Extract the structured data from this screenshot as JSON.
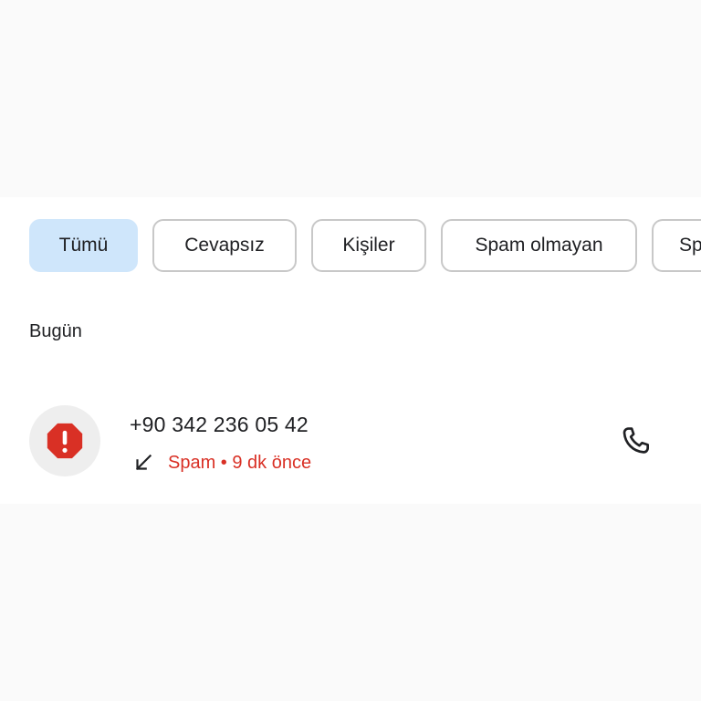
{
  "filters": {
    "chips": [
      {
        "label": "Tümü",
        "selected": true
      },
      {
        "label": "Cevapsız",
        "selected": false
      },
      {
        "label": "Kişiler",
        "selected": false
      },
      {
        "label": "Spam olmayan",
        "selected": false
      },
      {
        "label": "Sp",
        "selected": false
      }
    ]
  },
  "section": {
    "title": "Bugün"
  },
  "calls": [
    {
      "number": "+90 342 236 05 42",
      "status_text": "Spam • 9 dk önce",
      "direction_icon": "incoming-call-icon",
      "avatar_icon": "spam-warning-icon",
      "action_icon": "phone-icon"
    }
  ],
  "colors": {
    "selected_chip": "#cfe6fb",
    "spam_red": "#d93025",
    "background": "#fafafa",
    "panel": "#ffffff"
  }
}
